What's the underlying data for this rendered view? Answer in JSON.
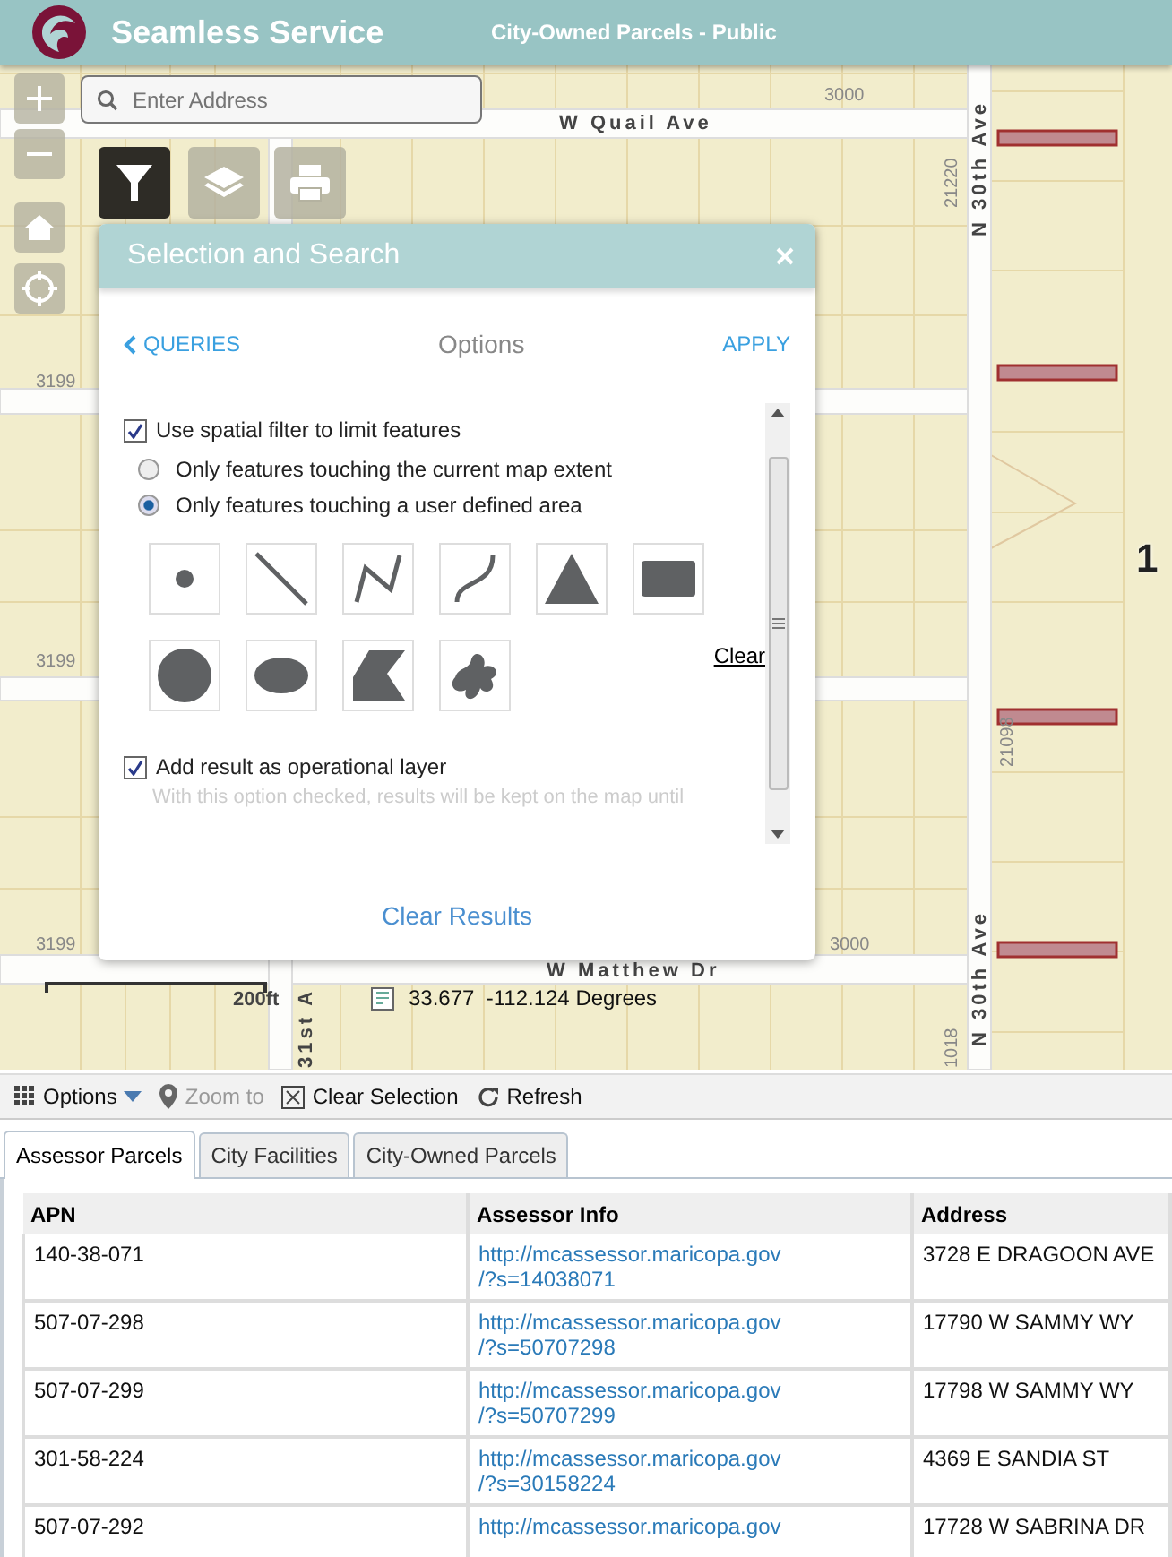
{
  "header": {
    "title": "Seamless Service",
    "subtitle": "City-Owned Parcels - Public"
  },
  "search": {
    "placeholder": "Enter Address"
  },
  "map_tools": [
    {
      "kind": "filter",
      "selected": true
    },
    {
      "kind": "layers",
      "selected": false
    },
    {
      "kind": "print",
      "selected": false
    }
  ],
  "map_labels": [
    "3000",
    "W Quail Ave",
    "N 30th Ave",
    "21220",
    "3199",
    "3199",
    "3199",
    "3000",
    "W Matthew Dr",
    "N 30th Ave",
    "21098",
    "1018",
    "1",
    "31st A"
  ],
  "panel": {
    "title": "Selection and Search",
    "back": "QUERIES",
    "heading": "Options",
    "apply": "APPLY",
    "spatial_filter": {
      "label": "Use spatial filter to limit features",
      "checked": true
    },
    "extent_options": [
      {
        "label": "Only features touching the current map extent",
        "selected": false
      },
      {
        "label": "Only features touching a user defined area",
        "selected": true
      }
    ],
    "shapes": [
      {
        "kind": "point"
      },
      {
        "kind": "line"
      },
      {
        "kind": "polyline"
      },
      {
        "kind": "freehand-line"
      },
      {
        "kind": "triangle"
      },
      {
        "kind": "rectangle"
      },
      {
        "kind": "circle"
      },
      {
        "kind": "ellipse"
      },
      {
        "kind": "polygon"
      },
      {
        "kind": "freehand-polygon"
      }
    ],
    "clear": "Clear",
    "operational_layer": {
      "label": "Add result as operational layer",
      "checked": true
    },
    "note": "With this option checked, results will be kept on the map until",
    "clear_results": "Clear Results"
  },
  "coordinates": "33.677  -112.124 Degrees",
  "scale": "200ft",
  "toolbar": [
    {
      "kind": "options",
      "label": "Options",
      "disabled": false
    },
    {
      "kind": "zoom",
      "label": "Zoom to",
      "disabled": true
    },
    {
      "kind": "clear",
      "label": "Clear Selection",
      "disabled": false
    },
    {
      "kind": "refresh",
      "label": "Refresh",
      "disabled": false
    }
  ],
  "tabs": [
    {
      "label": "Assessor Parcels",
      "selected": true
    },
    {
      "label": "City Facilities",
      "selected": false
    },
    {
      "label": "City-Owned Parcels",
      "selected": false
    }
  ],
  "table": {
    "columns": [
      "APN",
      "Assessor Info",
      "Address"
    ],
    "rows": [
      [
        "140-38-071",
        "http://mcassessor.maricopa.gov/?s=14038071",
        "3728 E DRAGOON AVE"
      ],
      [
        "507-07-298",
        "http://mcassessor.maricopa.gov/?s=50707298",
        "17790 W SAMMY WY"
      ],
      [
        "507-07-299",
        "http://mcassessor.maricopa.gov/?s=50707299",
        "17798 W SAMMY WY"
      ],
      [
        "301-58-224",
        "http://mcassessor.maricopa.gov/?s=30158224",
        "4369 E SANDIA ST"
      ],
      [
        "507-07-292",
        "http://mcassessor.maricopa.gov",
        "17728 W SABRINA DR"
      ]
    ]
  }
}
